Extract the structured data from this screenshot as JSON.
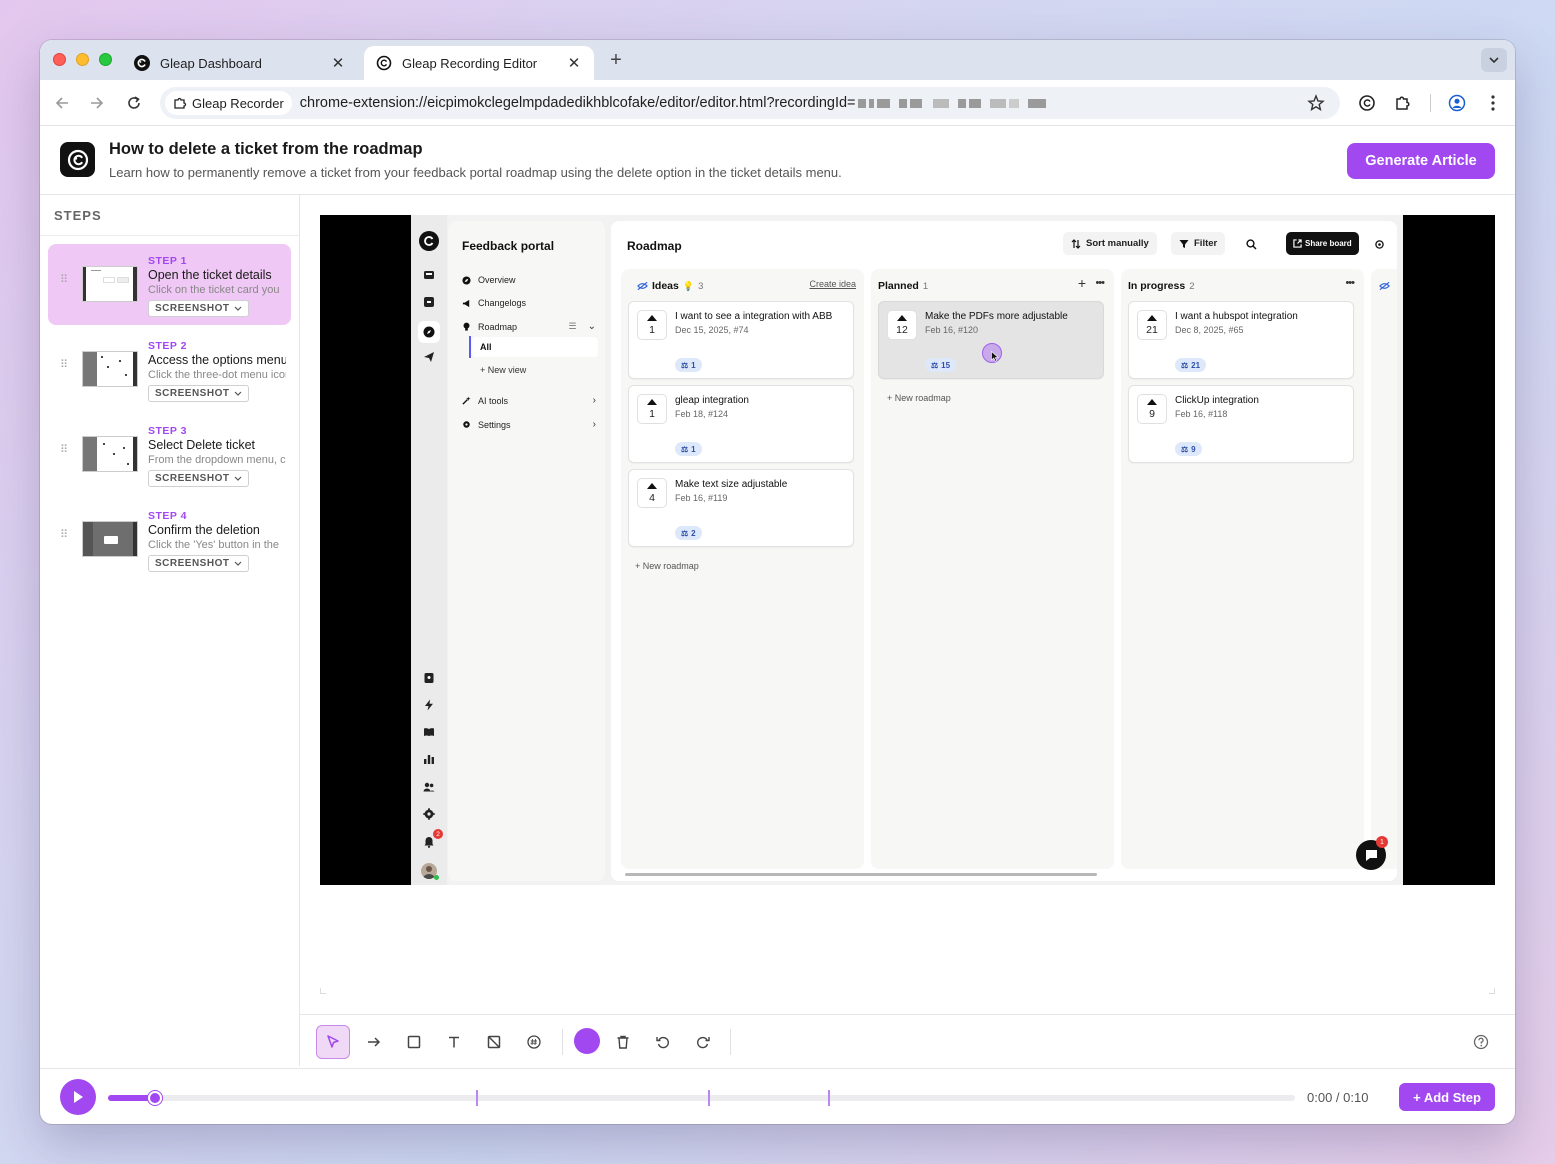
{
  "browser": {
    "tabs": [
      {
        "title": "Gleap Dashboard",
        "active": false
      },
      {
        "title": "Gleap Recording Editor",
        "active": true
      }
    ],
    "extension_chip": "Gleap Recorder",
    "url": "chrome-extension://eicpimokclegelmpdadedikhblcofake/editor/editor.html?recordingId="
  },
  "header": {
    "title": "How to delete a ticket from the roadmap",
    "subtitle": "Learn how to permanently remove a ticket from your feedback portal roadmap using the delete option in the ticket details menu.",
    "generate_label": "Generate Article"
  },
  "sidebar": {
    "heading": "STEPS",
    "steps": [
      {
        "num": "STEP 1",
        "title": "Open the ticket details",
        "desc": "Click on the ticket card you",
        "type": "SCREENSHOT",
        "active": true
      },
      {
        "num": "STEP 2",
        "title": "Access the options menu",
        "desc": "Click the three-dot menu icon",
        "type": "SCREENSHOT",
        "active": false
      },
      {
        "num": "STEP 3",
        "title": "Select Delete ticket",
        "desc": "From the dropdown menu, cl",
        "type": "SCREENSHOT",
        "active": false
      },
      {
        "num": "STEP 4",
        "title": "Confirm the deletion",
        "desc": "Click the 'Yes' button in the",
        "type": "SCREENSHOT",
        "active": false
      }
    ]
  },
  "screenshot": {
    "portal_title": "Feedback portal",
    "nav": {
      "overview": "Overview",
      "changelogs": "Changelogs",
      "roadmap": "Roadmap",
      "all": "All",
      "new_view": "+ New view",
      "ai_tools": "AI tools",
      "settings": "Settings"
    },
    "roadmap_title": "Roadmap",
    "sort_label": "Sort manually",
    "filter_label": "Filter",
    "share_label": "Share board",
    "notification_count": "2",
    "chat_badge": "1",
    "columns": [
      {
        "title": "Ideas",
        "count": "3",
        "action": "Create idea",
        "tickets": [
          {
            "votes": "1",
            "title": "I want to see a integration with ABB",
            "meta": "Dec 15, 2025, #74",
            "badge": "1"
          },
          {
            "votes": "1",
            "title": "gleap integration",
            "meta": "Feb 18, #124",
            "badge": "1"
          },
          {
            "votes": "4",
            "title": "Make text size adjustable",
            "meta": "Feb 16, #119",
            "badge": "2"
          }
        ],
        "new_roadmap": "+ New roadmap"
      },
      {
        "title": "Planned",
        "count": "1",
        "tickets": [
          {
            "votes": "12",
            "title": "Make the PDFs more adjustable",
            "meta": "Feb 16, #120",
            "badge": "15"
          }
        ],
        "new_roadmap": "+ New roadmap"
      },
      {
        "title": "In progress",
        "count": "2",
        "tickets": [
          {
            "votes": "21",
            "title": "I want a hubspot integration",
            "meta": "Dec 8, 2025, #65",
            "badge": "21"
          },
          {
            "votes": "9",
            "title": "ClickUp integration",
            "meta": "Feb 16, #118",
            "badge": "9"
          }
        ]
      }
    ]
  },
  "tools": [
    "select-tool",
    "arrow-tool",
    "rectangle-tool",
    "text-tool",
    "blur-tool",
    "number-tool",
    "color-picker",
    "delete-tool",
    "undo-tool",
    "redo-tool",
    "help-icon"
  ],
  "accent_color": "#a148f0",
  "timeline": {
    "time": "0:00 / 0:10",
    "progress": 0.04,
    "add_step_label": "+ Add Step"
  }
}
